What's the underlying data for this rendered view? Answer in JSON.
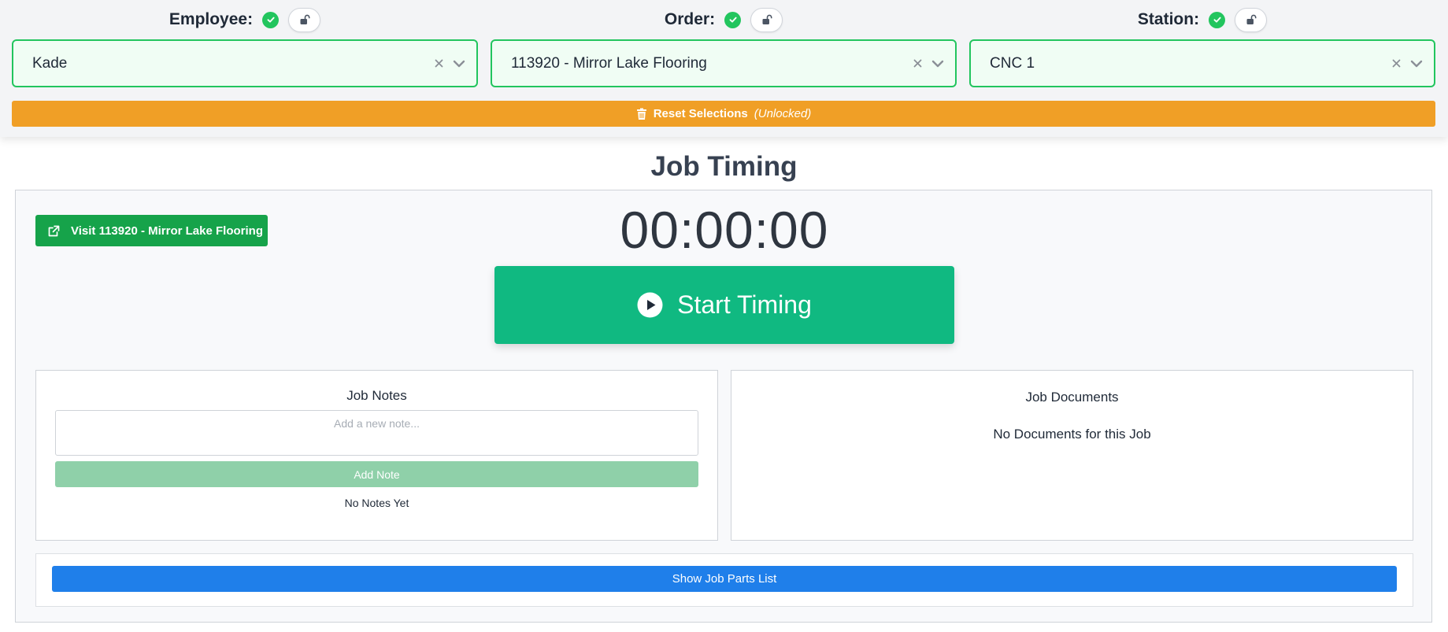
{
  "selectors": [
    {
      "label": "Employee:",
      "value": "Kade"
    },
    {
      "label": "Order:",
      "value": "113920 - Mirror Lake Flooring"
    },
    {
      "label": "Station:",
      "value": "CNC 1"
    }
  ],
  "reset": {
    "label": "Reset Selections",
    "state": "(Unlocked)"
  },
  "page_title": "Job Timing",
  "visit_button": "Visit 113920 - Mirror Lake Flooring",
  "timer": "00:00:00",
  "start_button": "Start Timing",
  "notes": {
    "title": "Job Notes",
    "placeholder": "Add a new note...",
    "add_label": "Add Note",
    "empty": "No Notes Yet"
  },
  "documents": {
    "title": "Job Documents",
    "empty": "No Documents for this Job"
  },
  "parts_button": "Show Job Parts List",
  "colors": {
    "success": "#22c55e",
    "warning": "#f09f26",
    "primary": "#1f7fea",
    "start": "#10b981"
  }
}
